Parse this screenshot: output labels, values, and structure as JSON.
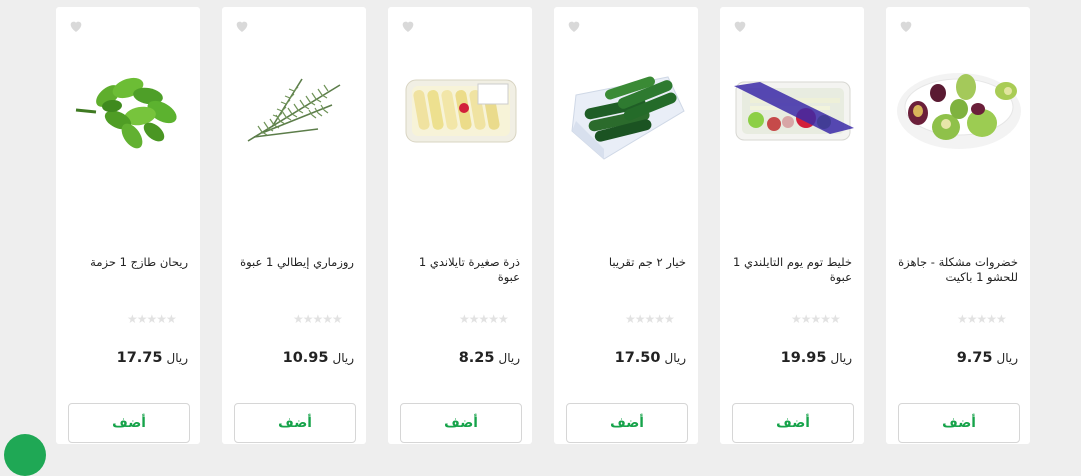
{
  "currency_label": "ريال",
  "add_label": "أضف",
  "stars": "★★★★★",
  "colors": {
    "accent": "#16a34a",
    "stars": "#e2e2e2",
    "chat": "#1fa855"
  },
  "products": [
    {
      "name": "خضروات مشكلة - جاهزة للحشو 1 باكيت",
      "price": "9.75"
    },
    {
      "name": "خليط توم يوم التايلندي 1 عبوة",
      "price": "19.95"
    },
    {
      "name": "خيار ٢ جم تقريبا",
      "price": "17.50"
    },
    {
      "name": "ذرة صغيرة تايلاندي 1 عبوة",
      "price": "8.25"
    },
    {
      "name": "روزماري إيطالي 1 عبوة",
      "price": "10.95"
    },
    {
      "name": "ريحان طازج 1 حزمة",
      "price": "17.75"
    }
  ]
}
